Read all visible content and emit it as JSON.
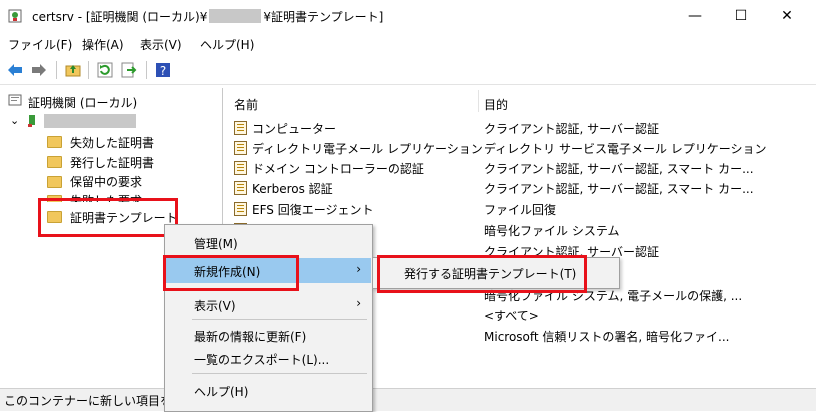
{
  "window": {
    "title_prefix": "certsrv - [証明機関 (ローカル)¥",
    "title_suffix": "¥証明書テンプレート]",
    "minimize": "—",
    "maximize": "☐",
    "close": "✕"
  },
  "menubar": [
    "ファイル(F)",
    "操作(A)",
    "表示(V)",
    "ヘルプ(H)"
  ],
  "tree": {
    "root": "証明機関 (ローカル)",
    "items": [
      "失効した証明書",
      "発行した証明書",
      "保留中の要求",
      "失敗した要求",
      "証明書テンプレート"
    ]
  },
  "list": {
    "columns": [
      "名前",
      "目的"
    ],
    "rows": [
      {
        "name": "コンピューター",
        "purpose": "クライアント認証, サーバー認証"
      },
      {
        "name": "ディレクトリ電子メール レプリケーション",
        "purpose": "ディレクトリ サービス電子メール レプリケーション"
      },
      {
        "name": "ドメイン コントローラーの認証",
        "purpose": "クライアント認証, サーバー認証, スマート カー..."
      },
      {
        "name": "Kerberos 認証",
        "purpose": "クライアント認証, サーバー認証, スマート カー..."
      },
      {
        "name": "EFS 回復エージェント",
        "purpose": "ファイル回復"
      },
      {
        "name": "",
        "purpose": "暗号化ファイル システム"
      },
      {
        "name": "",
        "purpose": "クライアント認証, サーバー認証"
      },
      {
        "name": "",
        "purpose": "暗号化ファイル システム, 電子メールの保護, ..."
      },
      {
        "name": "",
        "purpose": "<すべて>"
      },
      {
        "name": "",
        "purpose": "Microsoft 信頼リストの署名, 暗号化ファイ..."
      }
    ]
  },
  "context_menu": {
    "items": [
      "管理(M)",
      "新規作成(N)",
      "表示(V)",
      "最新の情報に更新(F)",
      "一覧のエクスポート(L)...",
      "ヘルプ(H)"
    ],
    "submenu_arrow": "›",
    "submenu_item": "発行する証明書テンプレート(T)"
  },
  "status": "このコンテナーに新しい項目を作",
  "colors": {
    "highlight": "#e8111a",
    "selected": "#99c9ef",
    "folder": "#f1c75c"
  }
}
